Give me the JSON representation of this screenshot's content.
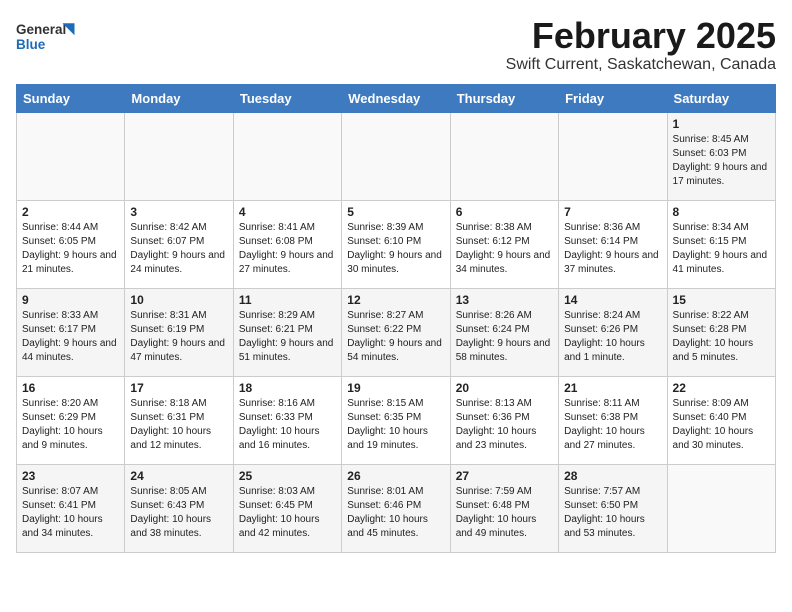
{
  "header": {
    "logo_general": "General",
    "logo_blue": "Blue",
    "month_title": "February 2025",
    "subtitle": "Swift Current, Saskatchewan, Canada"
  },
  "days_of_week": [
    "Sunday",
    "Monday",
    "Tuesday",
    "Wednesday",
    "Thursday",
    "Friday",
    "Saturday"
  ],
  "weeks": [
    [
      {
        "day": "",
        "info": ""
      },
      {
        "day": "",
        "info": ""
      },
      {
        "day": "",
        "info": ""
      },
      {
        "day": "",
        "info": ""
      },
      {
        "day": "",
        "info": ""
      },
      {
        "day": "",
        "info": ""
      },
      {
        "day": "1",
        "info": "Sunrise: 8:45 AM\nSunset: 6:03 PM\nDaylight: 9 hours and 17 minutes."
      }
    ],
    [
      {
        "day": "2",
        "info": "Sunrise: 8:44 AM\nSunset: 6:05 PM\nDaylight: 9 hours and 21 minutes."
      },
      {
        "day": "3",
        "info": "Sunrise: 8:42 AM\nSunset: 6:07 PM\nDaylight: 9 hours and 24 minutes."
      },
      {
        "day": "4",
        "info": "Sunrise: 8:41 AM\nSunset: 6:08 PM\nDaylight: 9 hours and 27 minutes."
      },
      {
        "day": "5",
        "info": "Sunrise: 8:39 AM\nSunset: 6:10 PM\nDaylight: 9 hours and 30 minutes."
      },
      {
        "day": "6",
        "info": "Sunrise: 8:38 AM\nSunset: 6:12 PM\nDaylight: 9 hours and 34 minutes."
      },
      {
        "day": "7",
        "info": "Sunrise: 8:36 AM\nSunset: 6:14 PM\nDaylight: 9 hours and 37 minutes."
      },
      {
        "day": "8",
        "info": "Sunrise: 8:34 AM\nSunset: 6:15 PM\nDaylight: 9 hours and 41 minutes."
      }
    ],
    [
      {
        "day": "9",
        "info": "Sunrise: 8:33 AM\nSunset: 6:17 PM\nDaylight: 9 hours and 44 minutes."
      },
      {
        "day": "10",
        "info": "Sunrise: 8:31 AM\nSunset: 6:19 PM\nDaylight: 9 hours and 47 minutes."
      },
      {
        "day": "11",
        "info": "Sunrise: 8:29 AM\nSunset: 6:21 PM\nDaylight: 9 hours and 51 minutes."
      },
      {
        "day": "12",
        "info": "Sunrise: 8:27 AM\nSunset: 6:22 PM\nDaylight: 9 hours and 54 minutes."
      },
      {
        "day": "13",
        "info": "Sunrise: 8:26 AM\nSunset: 6:24 PM\nDaylight: 9 hours and 58 minutes."
      },
      {
        "day": "14",
        "info": "Sunrise: 8:24 AM\nSunset: 6:26 PM\nDaylight: 10 hours and 1 minute."
      },
      {
        "day": "15",
        "info": "Sunrise: 8:22 AM\nSunset: 6:28 PM\nDaylight: 10 hours and 5 minutes."
      }
    ],
    [
      {
        "day": "16",
        "info": "Sunrise: 8:20 AM\nSunset: 6:29 PM\nDaylight: 10 hours and 9 minutes."
      },
      {
        "day": "17",
        "info": "Sunrise: 8:18 AM\nSunset: 6:31 PM\nDaylight: 10 hours and 12 minutes."
      },
      {
        "day": "18",
        "info": "Sunrise: 8:16 AM\nSunset: 6:33 PM\nDaylight: 10 hours and 16 minutes."
      },
      {
        "day": "19",
        "info": "Sunrise: 8:15 AM\nSunset: 6:35 PM\nDaylight: 10 hours and 19 minutes."
      },
      {
        "day": "20",
        "info": "Sunrise: 8:13 AM\nSunset: 6:36 PM\nDaylight: 10 hours and 23 minutes."
      },
      {
        "day": "21",
        "info": "Sunrise: 8:11 AM\nSunset: 6:38 PM\nDaylight: 10 hours and 27 minutes."
      },
      {
        "day": "22",
        "info": "Sunrise: 8:09 AM\nSunset: 6:40 PM\nDaylight: 10 hours and 30 minutes."
      }
    ],
    [
      {
        "day": "23",
        "info": "Sunrise: 8:07 AM\nSunset: 6:41 PM\nDaylight: 10 hours and 34 minutes."
      },
      {
        "day": "24",
        "info": "Sunrise: 8:05 AM\nSunset: 6:43 PM\nDaylight: 10 hours and 38 minutes."
      },
      {
        "day": "25",
        "info": "Sunrise: 8:03 AM\nSunset: 6:45 PM\nDaylight: 10 hours and 42 minutes."
      },
      {
        "day": "26",
        "info": "Sunrise: 8:01 AM\nSunset: 6:46 PM\nDaylight: 10 hours and 45 minutes."
      },
      {
        "day": "27",
        "info": "Sunrise: 7:59 AM\nSunset: 6:48 PM\nDaylight: 10 hours and 49 minutes."
      },
      {
        "day": "28",
        "info": "Sunrise: 7:57 AM\nSunset: 6:50 PM\nDaylight: 10 hours and 53 minutes."
      },
      {
        "day": "",
        "info": ""
      }
    ]
  ]
}
